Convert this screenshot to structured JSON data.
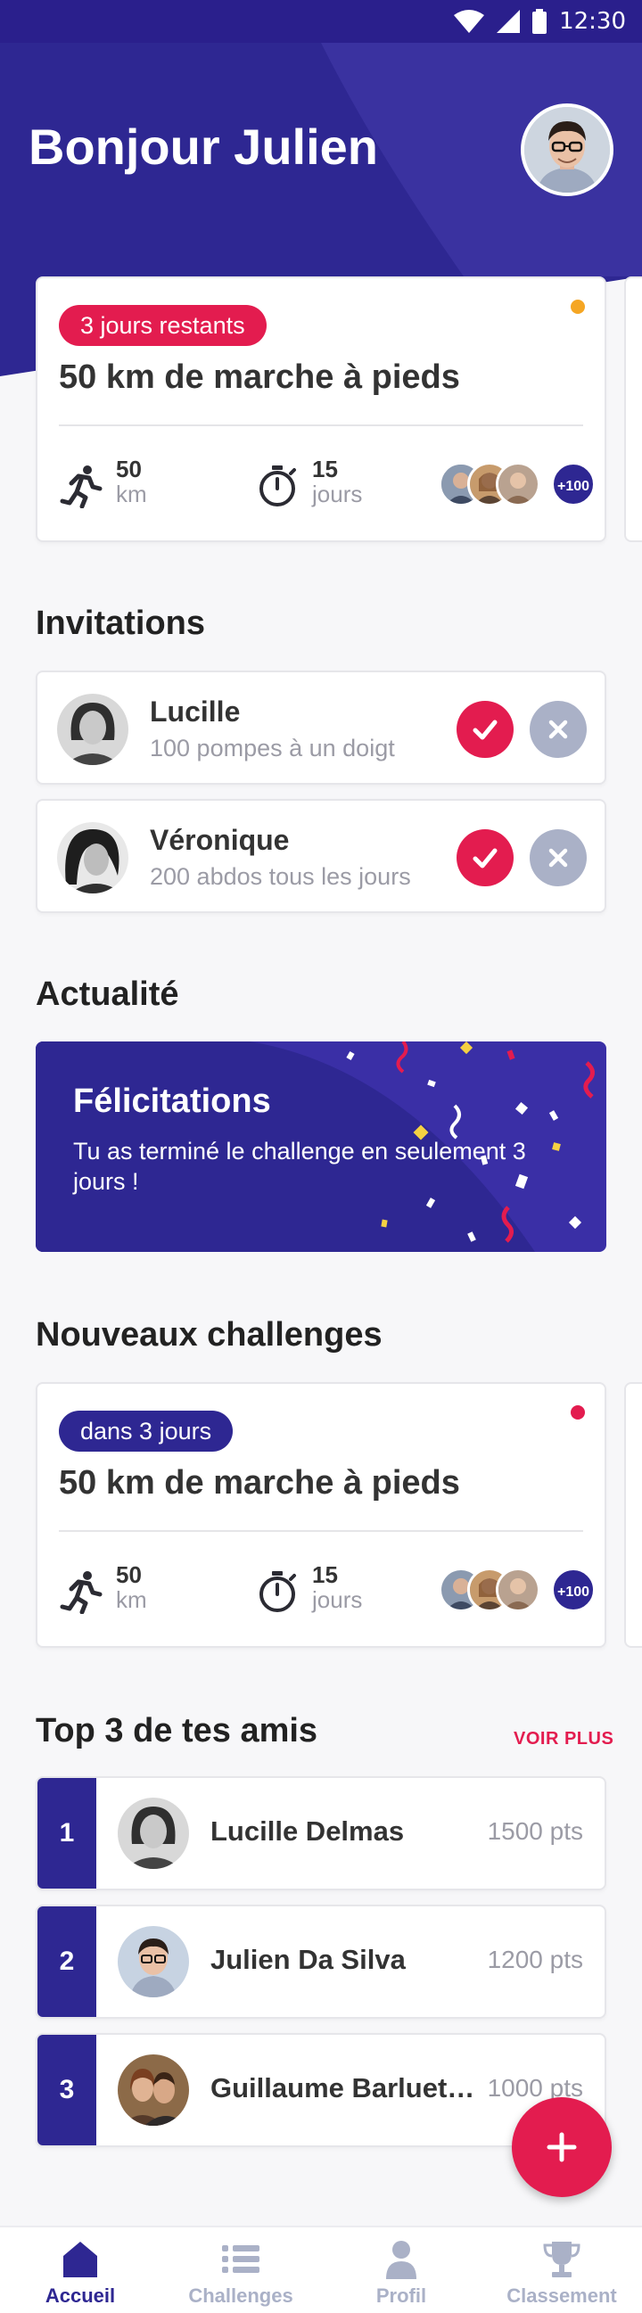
{
  "status_bar": {
    "time": "12:30"
  },
  "header": {
    "greeting": "Bonjour Julien"
  },
  "current_challenge": {
    "badge": "3 jours restants",
    "title": "50 km de marche à pieds",
    "distance_value": "50",
    "distance_unit": "km",
    "duration_value": "15",
    "duration_unit": "jours",
    "participants_more": "+100",
    "dot_color": "#f5a623"
  },
  "invitations": {
    "title": "Invitations",
    "items": [
      {
        "name": "Lucille",
        "challenge": "100 pompes à un doigt"
      },
      {
        "name": "Véronique",
        "challenge": "200 abdos tous les jours"
      }
    ]
  },
  "news": {
    "title": "Actualité",
    "card_title": "Félicitations",
    "card_text": "Tu as terminé le challenge en seulement 3 jours !"
  },
  "new_challenges": {
    "title": "Nouveaux challenges",
    "badge": "dans 3 jours",
    "card_title": "50 km de marche à pieds",
    "distance_value": "50",
    "distance_unit": "km",
    "duration_value": "15",
    "duration_unit": "jours",
    "participants_more": "+100",
    "dot_color": "#e31c4f"
  },
  "top_friends": {
    "title": "Top 3 de tes amis",
    "see_more": "VOIR PLUS",
    "items": [
      {
        "rank": "1",
        "name": "Lucille Delmas",
        "points": "1500 pts"
      },
      {
        "rank": "2",
        "name": "Julien Da Silva",
        "points": "1200 pts"
      },
      {
        "rank": "3",
        "name": "Guillaume Barluet Fontaine",
        "points": "1000 pts"
      }
    ]
  },
  "bottom_nav": {
    "items": [
      {
        "label": "Accueil",
        "icon": "home-icon",
        "active": true
      },
      {
        "label": "Challenges",
        "icon": "list-icon",
        "active": false
      },
      {
        "label": "Profil",
        "icon": "person-icon",
        "active": false
      },
      {
        "label": "Classement",
        "icon": "trophy-icon",
        "active": false
      }
    ]
  },
  "colors": {
    "primary": "#2e2792",
    "accent": "#e31c4f",
    "header_bg": "#2e2792"
  }
}
